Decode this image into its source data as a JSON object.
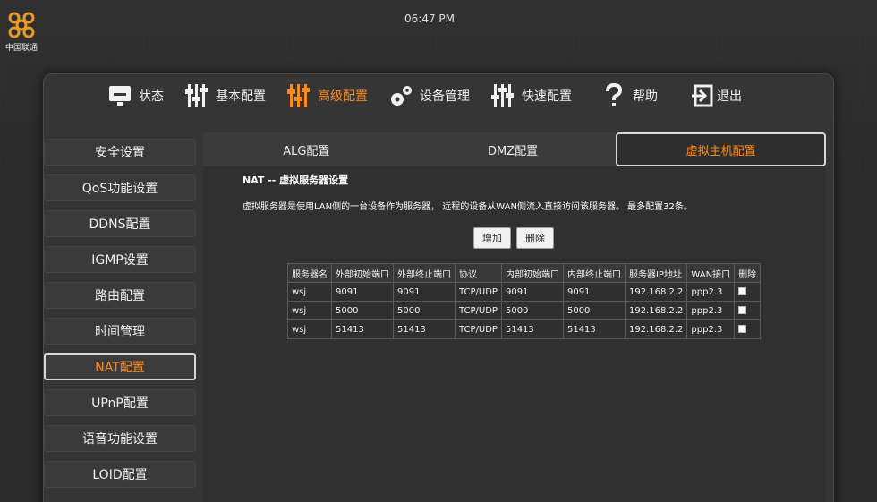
{
  "brand": {
    "logo_text": "中国联通"
  },
  "clock": "06:47 PM",
  "topnav": [
    {
      "label": "状态",
      "icon": "monitor-icon",
      "active": false
    },
    {
      "label": "基本配置",
      "icon": "sliders-icon",
      "active": false
    },
    {
      "label": "高级配置",
      "icon": "sliders-advanced-icon",
      "active": true
    },
    {
      "label": "设备管理",
      "icon": "gears-icon",
      "active": false
    },
    {
      "label": "快速配置",
      "icon": "sliders-quick-icon",
      "active": false
    },
    {
      "label": "帮助",
      "icon": "question-icon",
      "active": false
    },
    {
      "label": "退出",
      "icon": "logout-icon",
      "active": false
    }
  ],
  "sidebar": [
    {
      "label": "安全设置"
    },
    {
      "label": "QoS功能设置"
    },
    {
      "label": "DDNS配置"
    },
    {
      "label": "IGMP设置"
    },
    {
      "label": "路由配置"
    },
    {
      "label": "时间管理"
    },
    {
      "label": "NAT配置",
      "active": true
    },
    {
      "label": "UPnP配置"
    },
    {
      "label": "语音功能设置"
    },
    {
      "label": "LOID配置"
    }
  ],
  "tabs": [
    {
      "label": "ALG配置"
    },
    {
      "label": "DMZ配置"
    },
    {
      "label": "虚拟主机配置",
      "active": true
    }
  ],
  "section_title": "NAT -- 虚拟服务器设置",
  "description": "虚拟服务器是使用LAN侧的一台设备作为服务器， 远程的设备从WAN侧流入直接访问该服务器。 最多配置32条。",
  "buttons": {
    "add": "增加",
    "delete": "删除"
  },
  "table": {
    "headers": [
      "服务器名",
      "外部初始端口",
      "外部终止端口",
      "协议",
      "内部初始端口",
      "内部终止端口",
      "服务器IP地址",
      "WAN接口",
      "删除"
    ],
    "rows": [
      [
        "wsj",
        "9091",
        "9091",
        "TCP/UDP",
        "9091",
        "9091",
        "192.168.2.2",
        "ppp2.3"
      ],
      [
        "wsj",
        "5000",
        "5000",
        "TCP/UDP",
        "5000",
        "5000",
        "192.168.2.2",
        "ppp2.3"
      ],
      [
        "wsj",
        "51413",
        "51413",
        "TCP/UDP",
        "51413",
        "51413",
        "192.168.2.2",
        "ppp2.3"
      ]
    ]
  },
  "colors": {
    "accent": "#ff8a1c",
    "background": "#2b2b2b",
    "panel": "#353535"
  }
}
